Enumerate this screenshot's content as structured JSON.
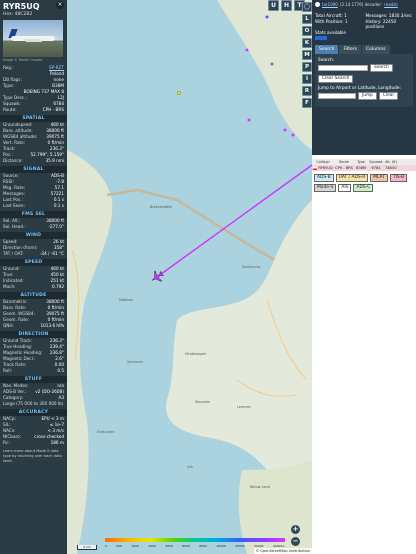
{
  "aircraft": {
    "callsign": "RYR5UQ",
    "hex_label": "Hex: 48C2B2",
    "photo_credit": "Image © Martin Oswald"
  },
  "info_rows": [
    {
      "k": "Reg.:",
      "v": "SP-RZT",
      "link": true
    },
    {
      "k": "",
      "v": "Poland"
    },
    {
      "k": "DB flags:",
      "v": "none"
    },
    {
      "k": "Type:",
      "v": "B38M"
    },
    {
      "k": "",
      "v": "BOEING 737 MAX 8"
    },
    {
      "k": "Type Desc.:",
      "v": "L2J"
    },
    {
      "k": "Squawk:",
      "v": "6784"
    },
    {
      "k": "Route:",
      "v": "CPH - BRS"
    }
  ],
  "sections": [
    {
      "title": "SPATIAL",
      "rows": [
        {
          "k": "Groundspeed:",
          "v": "460 kt"
        },
        {
          "k": "Baro. altitude:",
          "v": "38000 ft"
        },
        {
          "k": "WGS84 altitude:",
          "v": "39075 ft"
        },
        {
          "k": "Vert. Rate:",
          "v": "0 ft/min"
        },
        {
          "k": "Track:",
          "v": "236.3°"
        },
        {
          "k": "Pos.:",
          "v": "52.799°, 5.159°"
        },
        {
          "k": "Distance:",
          "v": "35.9 nmi"
        }
      ]
    },
    {
      "title": "SIGNAL",
      "rows": [
        {
          "k": "Source:",
          "v": "ADS-B"
        },
        {
          "k": "RSSI:",
          "v": "-7.8"
        },
        {
          "k": "Msg. Rate:",
          "v": "57.1"
        },
        {
          "k": "Messages:",
          "v": "57221"
        },
        {
          "k": "Last Pos.:",
          "v": "0.1 s"
        },
        {
          "k": "Last Seen:",
          "v": "0.1 s"
        }
      ]
    },
    {
      "title": "FMS SEL",
      "rows": [
        {
          "k": "Sel. Alt.:",
          "v": "38000 ft"
        },
        {
          "k": "Sel. Head.:",
          "v": "-277.0°"
        }
      ]
    },
    {
      "title": "WIND",
      "rows": [
        {
          "k": "Speed:",
          "v": "26 kt"
        },
        {
          "k": "Direction (from):",
          "v": "358°"
        },
        {
          "k": "TAT / OAT:",
          "v": "-34 / -61 °C"
        }
      ]
    },
    {
      "title": "SPEED",
      "rows": [
        {
          "k": "Ground:",
          "v": "460 kt"
        },
        {
          "k": "True:",
          "v": "450 kt"
        },
        {
          "k": "Indicated:",
          "v": "251 kt"
        },
        {
          "k": "Mach:",
          "v": "0.792"
        }
      ]
    },
    {
      "title": "ALTITUDE",
      "rows": [
        {
          "k": "Barometric:",
          "v": "38000 ft"
        },
        {
          "k": "Baro. Rate:",
          "v": "0 ft/min"
        },
        {
          "k": "Geom. WGS84:",
          "v": "39075 ft"
        },
        {
          "k": "Geom. Rate:",
          "v": "0 ft/min"
        },
        {
          "k": "QNH:",
          "v": "1013.6 hPa"
        }
      ]
    },
    {
      "title": "DIRECTION",
      "rows": [
        {
          "k": "Ground Track:",
          "v": "236.3°"
        },
        {
          "k": "True Heading:",
          "v": "239.4°"
        },
        {
          "k": "Magnetic Heading:",
          "v": "236.8°"
        },
        {
          "k": "Magnetic Decl.:",
          "v": "2.6°"
        },
        {
          "k": "Track Rate:",
          "v": "0.00"
        },
        {
          "k": "Roll:",
          "v": "0.5"
        }
      ]
    },
    {
      "title": "STUFF",
      "rows": [
        {
          "k": "Nav. Modes:",
          "v": "n/a"
        },
        {
          "k": "ADS-B Ver.:",
          "v": "v2 (DO-260B)"
        },
        {
          "k": "Category:",
          "v": "A3"
        },
        {
          "k": "Large (75 000 to 300 000 lb)",
          "v": ""
        }
      ]
    },
    {
      "title": "ACCURACY",
      "rows": [
        {
          "k": "NACp:",
          "v": "EPU < 3 m"
        },
        {
          "k": "SIL:",
          "v": "≤ 1e-7"
        },
        {
          "k": "NACv:",
          "v": "< 3 m/s"
        },
        {
          "k": "NICbaro:",
          "v": "cross-checked"
        },
        {
          "k": "Rc:",
          "v": "186 m"
        }
      ]
    }
  ],
  "footer_note": "Learn more about Mode S data type by hovering over each data label.",
  "map": {
    "labels": {
      "breezanddijk": "Breezanddijk",
      "makkum": "Makkum",
      "hindeloopen": "Hindeloopen",
      "lemmer": "Lemmer",
      "stavoren": "Stavoren",
      "enkhuizen": "Enkhuizen",
      "urk": "Urk",
      "nieuw_land": "Nieuw Land"
    },
    "watermark_1": "Waddenzee",
    "watermark_2": "IJsselmeer",
    "attribution": "© OpenStreetMap contributors",
    "scale_label": "5 km",
    "legend_ticks": [
      "0",
      "500",
      "1000",
      "2000",
      "4000",
      "6000",
      "8000",
      "10000",
      "20000",
      "30000",
      "40000+"
    ],
    "top_buttons": [
      "U",
      "H",
      "T"
    ],
    "side_buttons": [
      "◯",
      "L",
      "O",
      "K",
      "M",
      "P",
      "I",
      "R",
      "F"
    ],
    "zoom_in": "+",
    "zoom_out": "−",
    "track_color": "#cc33ff"
  },
  "right_panel": {
    "version_link": "tar1090",
    "version_text": "(3.14.1776) decoder:",
    "version_tail": "readsb",
    "stats": [
      {
        "label": "Total Aircraft: 1",
        "value": "Messages: 1830.3/sec"
      },
      {
        "label": "With Position: 1",
        "value": "History: 22450 positions"
      }
    ],
    "stats_available": "Stats available",
    "tabs": [
      "Search",
      "Filters",
      "Columns"
    ],
    "search_label": "Search:",
    "search_button": "Search",
    "clear_search": "Clear Search",
    "jump_label": "Jump to Airport or Latitude, Longitude:",
    "jump_button": "Jump",
    "clear_button": "Clear",
    "table_headers": [
      "Callsign",
      "Route",
      "Type",
      "Squawk",
      "Alt. (ft)",
      ""
    ],
    "table_rows": [
      [
        "RYR5UQ",
        "CPH - BRS",
        "B38M",
        "6784",
        "38000",
        ""
      ]
    ],
    "sources": [
      {
        "label": "ADS-B",
        "color": "#c7ecf7"
      },
      {
        "label": "UAT / ADS-R",
        "color": "#f7e3a2"
      },
      {
        "label": "MLAT",
        "color": "#f3c2a2"
      },
      {
        "label": "TIS-B",
        "color": "#f5b8c0"
      },
      {
        "label": "Mode-S",
        "color": "#d6d6d6"
      },
      {
        "label": "AIS",
        "color": "#ffffff"
      },
      {
        "label": "ADS-C",
        "color": "#c9f0c9"
      }
    ]
  }
}
